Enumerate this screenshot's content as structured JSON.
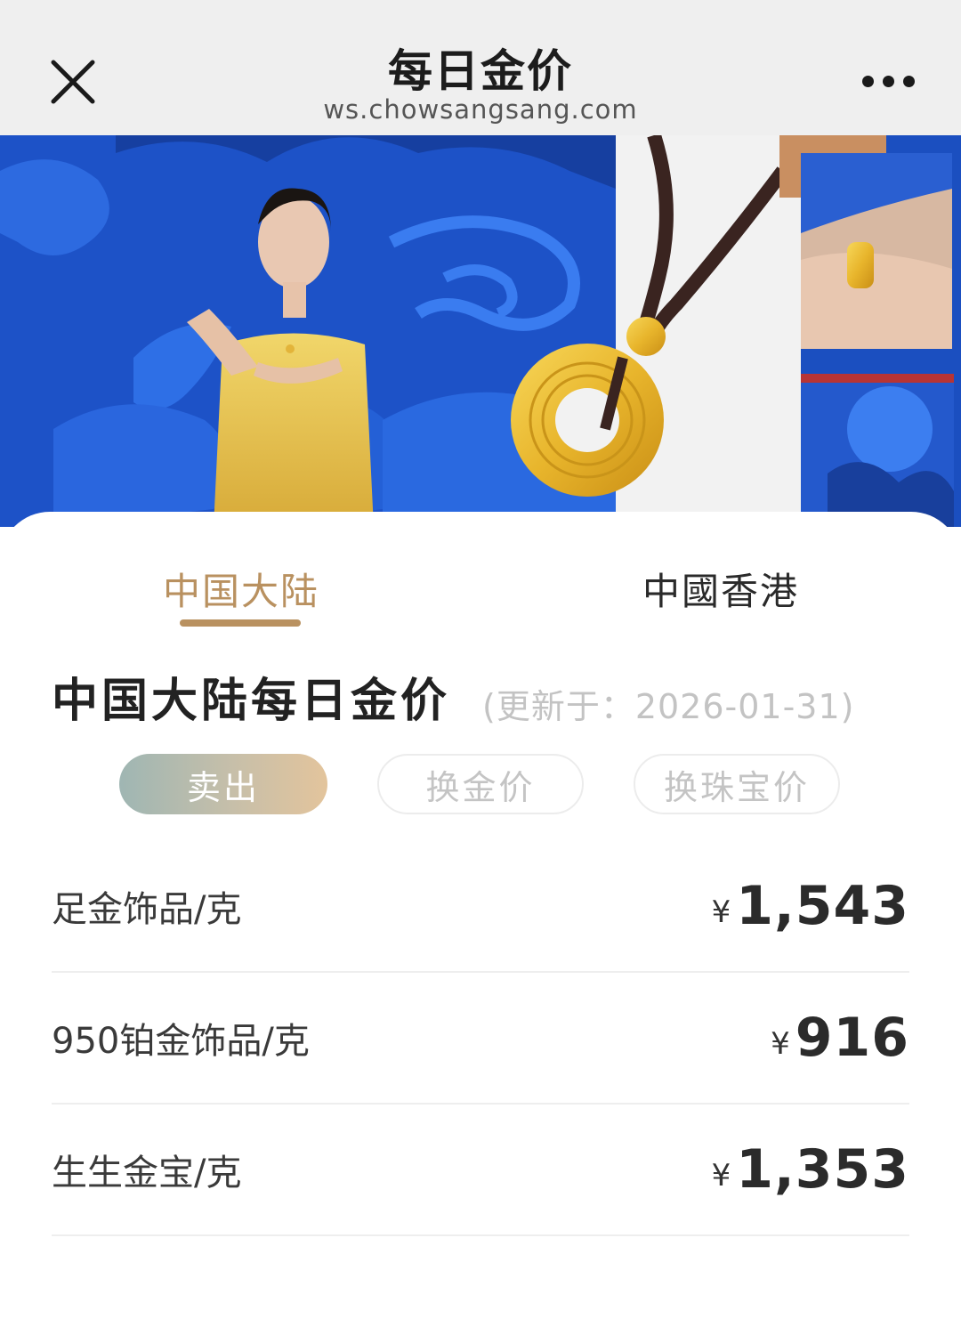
{
  "navbar": {
    "title": "每日金价",
    "domain": "ws.chowsangsang.com",
    "close_icon": "close-icon",
    "more_icon": "more-dots-icon"
  },
  "banner": {
    "description_icon": "promo-banner-image"
  },
  "tabs": [
    {
      "label": "中国大陆",
      "active": true
    },
    {
      "label": "中國香港",
      "active": false
    }
  ],
  "section": {
    "title": "中国大陆每日金价",
    "updated": "(更新于：2026-01-31)"
  },
  "price_types": [
    {
      "label": "卖出",
      "active": true
    },
    {
      "label": "换金价",
      "active": false
    },
    {
      "label": "换珠宝价",
      "active": false
    }
  ],
  "prices": [
    {
      "name": "足金饰品/克",
      "currency": "¥",
      "amount": "1,543"
    },
    {
      "name": "950铂金饰品/克",
      "currency": "¥",
      "amount": "916"
    },
    {
      "name": "生生金宝/克",
      "currency": "¥",
      "amount": "1,353"
    }
  ],
  "colors": {
    "accent_gold": "#b99160",
    "banner_blue": "#1b4fc0",
    "navbar_bg": "#efefef"
  }
}
